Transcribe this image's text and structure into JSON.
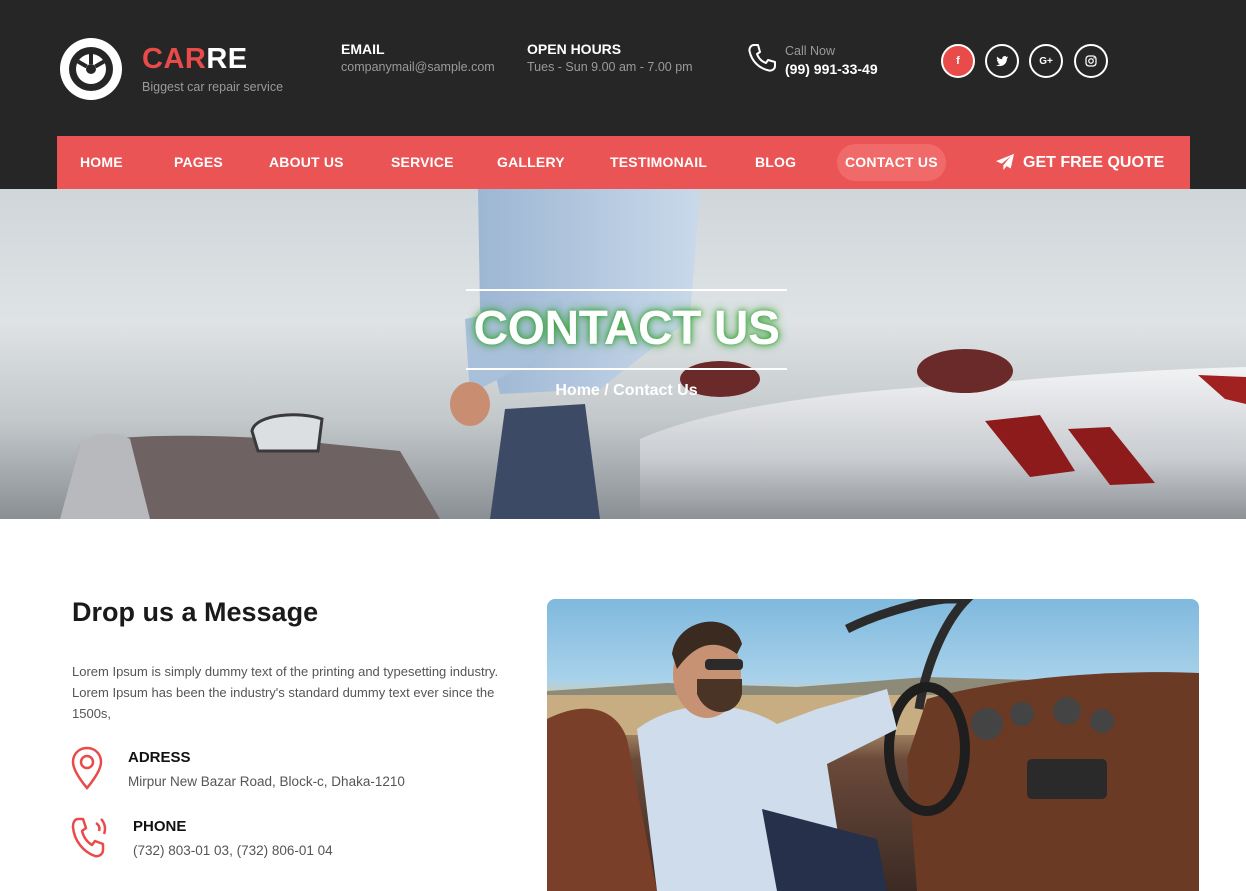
{
  "header": {
    "brand_part1": "CAR",
    "brand_part2": "RE",
    "tagline": "Biggest car repair service",
    "email_title": "EMAIL",
    "email_value": "companymail@sample.com",
    "hours_title": "OPEN HOURS",
    "hours_value": "Tues - Sun 9.00 am - 7.00 pm",
    "call_label": "Call Now",
    "phone": "(99) 991-33-49",
    "social": [
      {
        "name": "facebook",
        "glyph": "f"
      },
      {
        "name": "twitter",
        "glyph": "t"
      },
      {
        "name": "google-plus",
        "glyph": "G+"
      },
      {
        "name": "instagram",
        "glyph": "◎"
      }
    ]
  },
  "nav": {
    "items": [
      "HOME",
      "PAGES",
      "ABOUT US",
      "SERVICE",
      "GALLERY",
      "TESTIMONAIL",
      "BLOG",
      "CONTACT US"
    ],
    "active": "CONTACT US",
    "quote_label": "GET FREE QUOTE"
  },
  "hero": {
    "title": "CONTACT US",
    "breadcrumb": "Home / Contact Us"
  },
  "contact": {
    "heading": "Drop us a Message",
    "intro": "Lorem Ipsum is simply dummy text of the printing and typesetting industry. Lorem Ipsum has been the industry's standard dummy text ever since the 1500s,",
    "address_title": "ADRESS",
    "address_value": "Mirpur New Bazar Road, Block-c, Dhaka-1210",
    "phone_title": "PHONE",
    "phone_value": "(732) 803-01 03, (732) 806-01 04"
  },
  "colors": {
    "accent": "#ea5455",
    "header_bg": "#262626"
  }
}
